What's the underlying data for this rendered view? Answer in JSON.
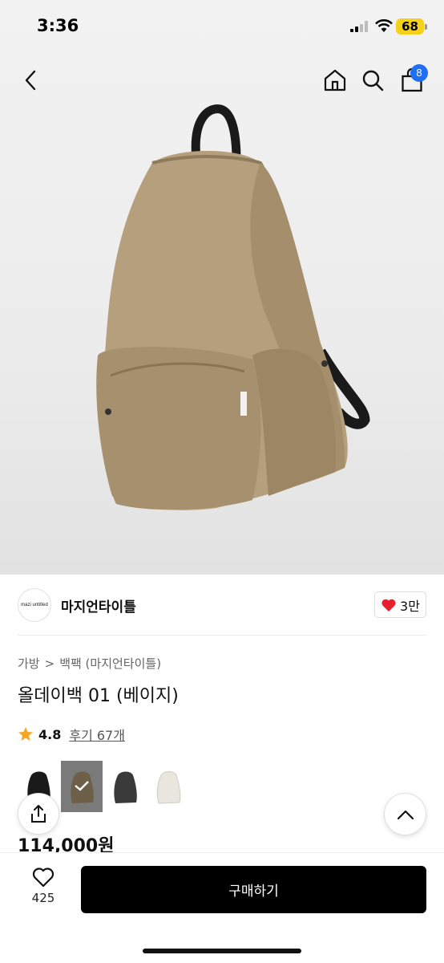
{
  "status_bar": {
    "time": "3:36",
    "battery": "68"
  },
  "nav": {
    "cart_count": "8"
  },
  "brand": {
    "logo_text": "mazi untitled",
    "name": "마지언타이틀",
    "likes": "3만"
  },
  "breadcrumb": {
    "category": "가방",
    "separator": ">",
    "subcategory": "백팩 (마지언타이틀)"
  },
  "product": {
    "title": "올데이백 01 (베이지)",
    "rating": "4.8",
    "reviews_label": "후기 67개",
    "price": "114,000원"
  },
  "swatches": [
    {
      "color": "black",
      "selected": false
    },
    {
      "color": "beige",
      "selected": true
    },
    {
      "color": "charcoal",
      "selected": false
    },
    {
      "color": "ivory",
      "selected": false
    }
  ],
  "bottom_bar": {
    "wish_count": "425",
    "buy_label": "구매하기"
  },
  "colors": {
    "accent": "#1f6ff5",
    "battery": "#f5d11a",
    "heart": "#e8202e",
    "star": "#f5a623",
    "buy_button": "#000000"
  }
}
